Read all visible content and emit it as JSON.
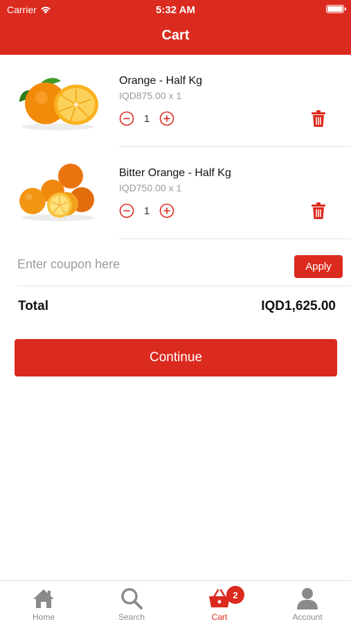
{
  "status_bar": {
    "carrier": "Carrier",
    "time": "5:32 AM"
  },
  "header": {
    "title": "Cart"
  },
  "cart": {
    "items": [
      {
        "name": "Orange - Half Kg",
        "price_line": "IQD875.00 x 1",
        "quantity": "1"
      },
      {
        "name": "Bitter Orange - Half Kg",
        "price_line": "IQD750.00 x 1",
        "quantity": "1"
      }
    ]
  },
  "coupon": {
    "placeholder": "Enter coupon here",
    "value": "",
    "apply_label": "Apply"
  },
  "total": {
    "label": "Total",
    "value": "IQD1,625.00"
  },
  "continue_label": "Continue",
  "tabbar": {
    "tabs": [
      {
        "label": "Home",
        "icon": "home-icon"
      },
      {
        "label": "Search",
        "icon": "search-icon"
      },
      {
        "label": "Cart",
        "icon": "cart-icon",
        "badge": "2",
        "active": true
      },
      {
        "label": "Account",
        "icon": "account-icon"
      }
    ]
  },
  "colors": {
    "accent": "#db2a1e",
    "muted_text": "#9a9a9a",
    "inactive_tab": "#8a8a8a"
  }
}
